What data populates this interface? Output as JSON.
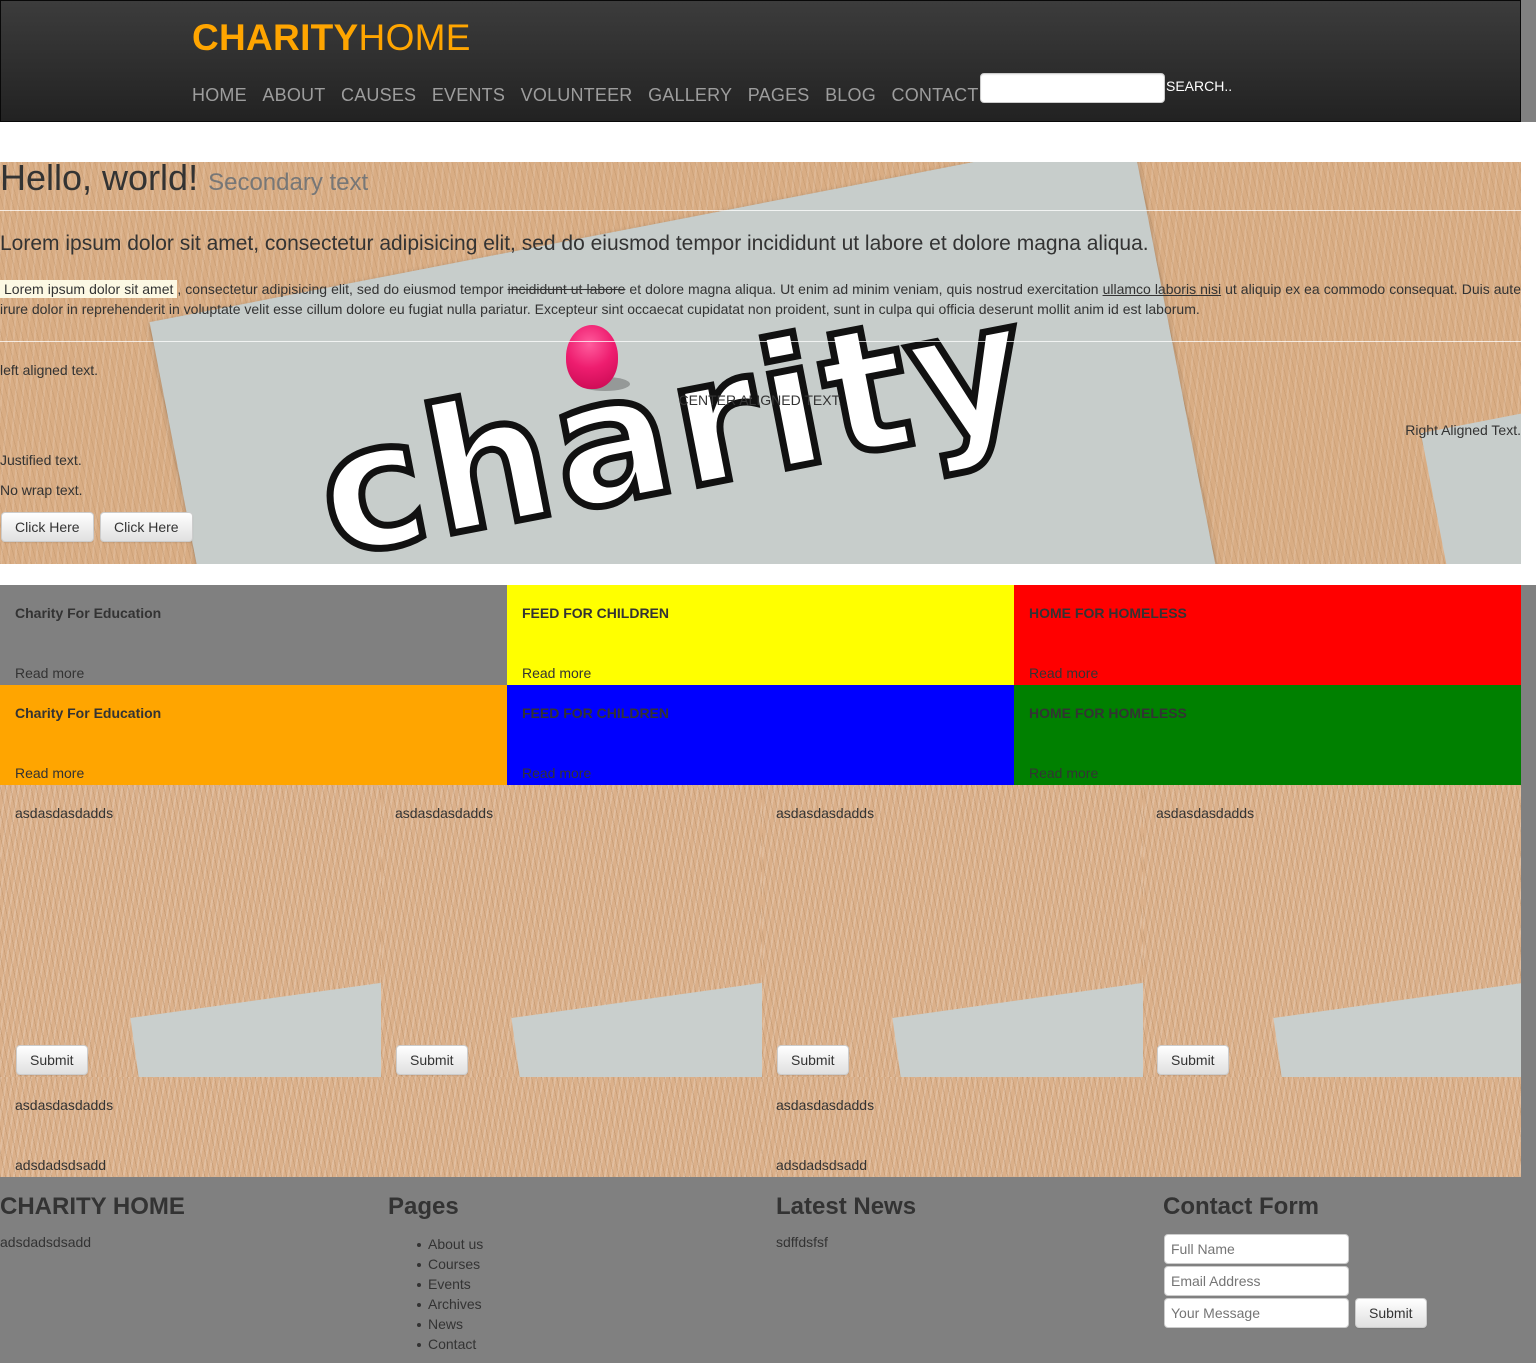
{
  "brand": {
    "bold": "CHARITY",
    "light": "HOME"
  },
  "nav": [
    "HOME",
    "ABOUT",
    "CAUSES",
    "EVENTS",
    "VOLUNTEER",
    "GALLERY",
    "PAGES",
    "BLOG",
    "CONTACT"
  ],
  "search": {
    "placeholder": "",
    "button": "SEARCH.."
  },
  "hero": {
    "title": "Hello, world!",
    "subtitle": "Secondary text",
    "lead": "Lorem ipsum dolor sit amet, consectetur adipisicing elit, sed do eiusmod tempor incididunt ut labore et dolore magna aliqua.",
    "mark": "Lorem ipsum dolor sit amet",
    "p1": ", consectetur adipisicing elit, sed do eiusmod tempor ",
    "strike": "incididunt ut labore",
    "p2": " et dolore magna aliqua. Ut enim ad minim veniam, quis nostrud exercitation ",
    "underline": "ullamco laboris nisi",
    "p3": " ut aliquip ex ea commodo consequat. Duis aute irure dolor in reprehenderit in voluptate velit esse cillum dolore eu fugiat nulla pariatur. Excepteur sint occaecat cupidatat non proident, sunt in culpa qui officia deserunt mollit anim id est laborum.",
    "left": "left aligned text.",
    "center": "CENTER ALIGNED TEXT.",
    "right": "Right Aligned Text.",
    "justified": "Justified text.",
    "nowrap": "No wrap text.",
    "buttons": [
      "Click Here",
      "Click Here"
    ]
  },
  "causes": [
    {
      "title": "Charity For Education",
      "more": "Read more",
      "color": "#808080"
    },
    {
      "title": "FEED FOR CHILDREN",
      "more": "Read more",
      "color": "#ffff00"
    },
    {
      "title": "HOME FOR HOMELESS",
      "more": "Read more",
      "color": "#ff0000"
    },
    {
      "title": "Charity For Education",
      "more": "Read more",
      "color": "#ffa500"
    },
    {
      "title": "FEED FOR CHILDREN",
      "more": "Read more",
      "color": "#0000ff"
    },
    {
      "title": "HOME FOR HOMELESS",
      "more": "Read more",
      "color": "#008000"
    }
  ],
  "panels": [
    {
      "text": "asdasdasdadds",
      "button": "Submit"
    },
    {
      "text": "asdasdasdadds",
      "button": "Submit"
    },
    {
      "text": "asdasdasdadds",
      "button": "Submit"
    },
    {
      "text": "asdasdasdadds",
      "button": "Submit"
    }
  ],
  "panels2": [
    {
      "text": "asdasdasdadds",
      "sub": "adsdadsdsadd"
    },
    {
      "text": "asdasdasdadds",
      "sub": "adsdadsdsadd"
    }
  ],
  "footer": {
    "about": {
      "title": "CHARITY HOME",
      "text": "adsdadsdsadd"
    },
    "pages": {
      "title": "Pages",
      "items": [
        "About us",
        "Courses",
        "Events",
        "Archives",
        "News",
        "Contact"
      ]
    },
    "news": {
      "title": "Latest News",
      "text": "sdffdsfsf"
    },
    "contact": {
      "title": "Contact Form",
      "name_placeholder": "Full Name",
      "email_placeholder": "Email Address",
      "message_placeholder": "Your Message",
      "submit": "Submit"
    }
  }
}
